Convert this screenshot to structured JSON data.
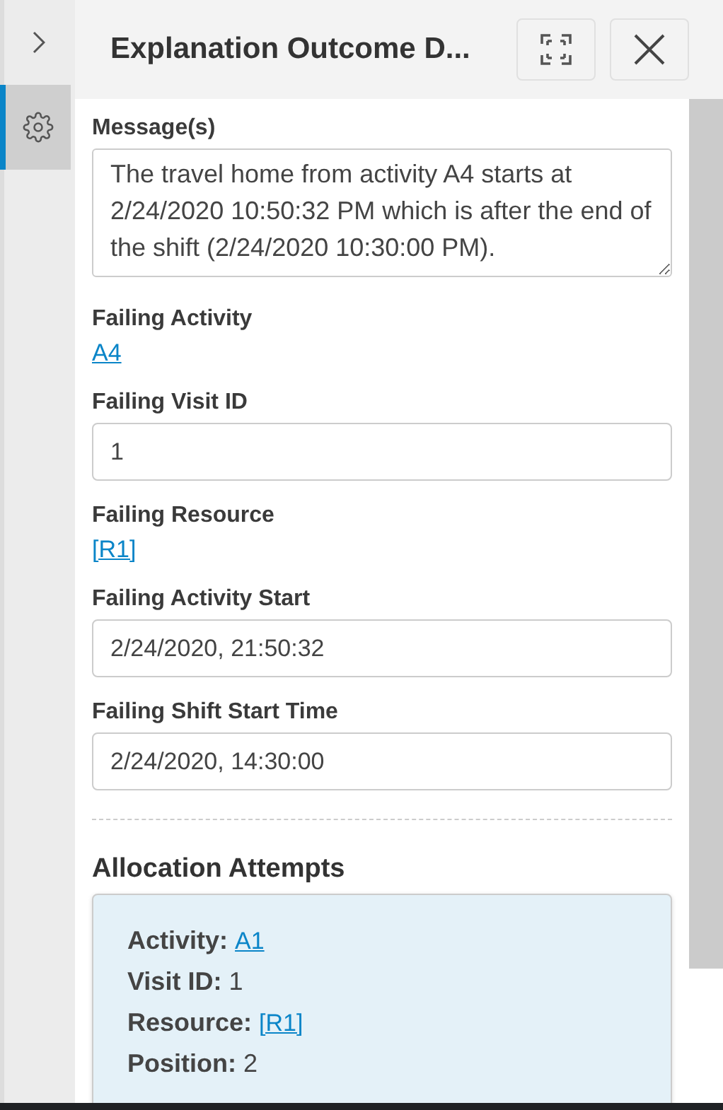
{
  "rail": {
    "items": [
      {
        "kind": "chevron",
        "selected": false
      },
      {
        "kind": "settings",
        "selected": true
      }
    ]
  },
  "header": {
    "title": "Explanation Outcome D..."
  },
  "fields": [
    {
      "kind": "textarea",
      "label": "Message(s)",
      "value": "The travel home from activity A4 starts at 2/24/2020 10:50:32 PM which is after the end of the shift (2/24/2020 10:30:00 PM)."
    },
    {
      "kind": "link",
      "label": "Failing Activity",
      "value": "A4"
    },
    {
      "kind": "input",
      "label": "Failing Visit ID",
      "value": "1"
    },
    {
      "kind": "link",
      "label": "Failing Resource",
      "value": "[R1]"
    },
    {
      "kind": "input",
      "label": "Failing Activity Start",
      "value": "2/24/2020, 21:50:32"
    },
    {
      "kind": "input",
      "label": "Failing Shift Start Time",
      "value": "2/24/2020, 14:30:00"
    }
  ],
  "allocation_attempts": {
    "title": "Allocation Attempts",
    "rows": [
      {
        "label": "Activity:",
        "value": "A1",
        "kind": "link"
      },
      {
        "label": "Visit ID:",
        "value": "1",
        "kind": "text"
      },
      {
        "label": "Resource:",
        "value": "[R1]",
        "kind": "link"
      },
      {
        "label": "Position:",
        "value": "2",
        "kind": "text"
      }
    ]
  }
}
